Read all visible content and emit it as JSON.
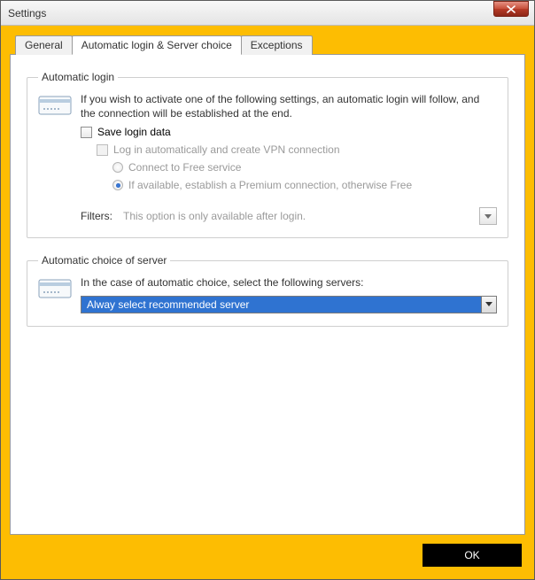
{
  "window": {
    "title": "Settings"
  },
  "tabs": {
    "general": "General",
    "auto": "Automatic login & Server choice",
    "exceptions": "Exceptions"
  },
  "group_auto_login": {
    "legend": "Automatic login",
    "help": "If you wish to activate one of the following settings, an automatic login will follow, and the connection will be established at the end.",
    "save_login": "Save login data",
    "auto_vpn": "Log in automatically and create VPN connection",
    "radio_free": "Connect to Free service",
    "radio_premium": "If available, establish a Premium connection, otherwise Free",
    "filters_label": "Filters:",
    "filters_text": "This option is only available after login."
  },
  "group_server": {
    "legend": "Automatic choice of server",
    "help": "In the case of automatic choice, select the following servers:",
    "combo_value": "Alway select recommended server"
  },
  "buttons": {
    "ok": "OK"
  }
}
